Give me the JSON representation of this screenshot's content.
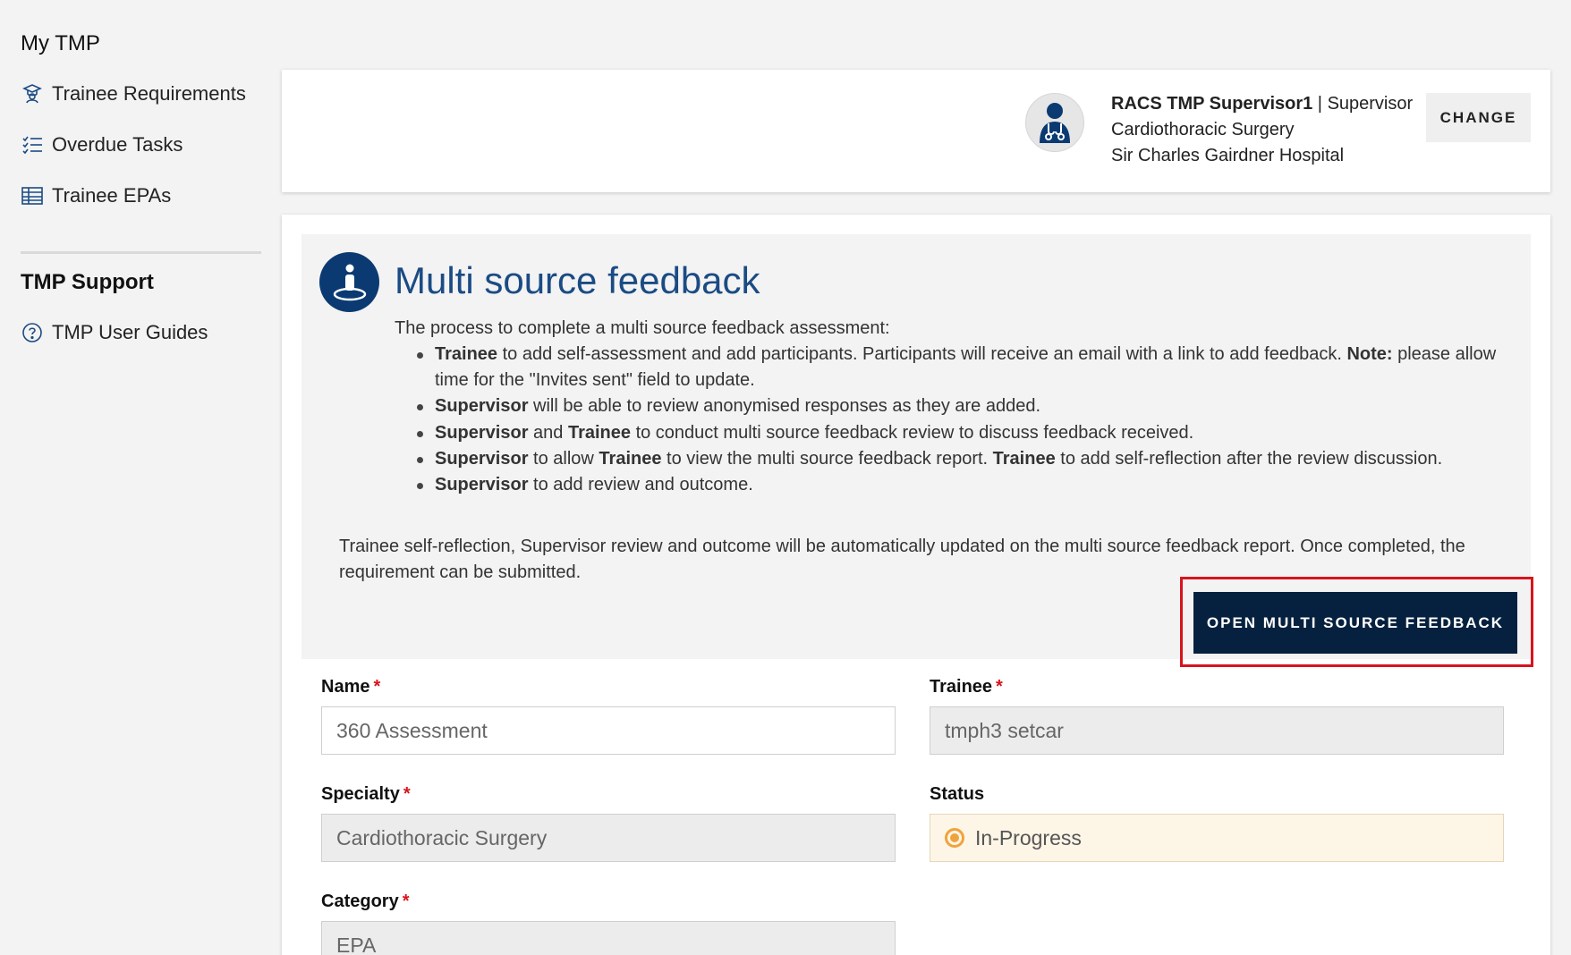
{
  "sidebar": {
    "title": "My TMP",
    "items": [
      {
        "label": "Trainee Requirements",
        "icon": "graduation-icon"
      },
      {
        "label": "Overdue Tasks",
        "icon": "checklist-icon"
      },
      {
        "label": "Trainee EPAs",
        "icon": "table-icon"
      }
    ],
    "support_title": "TMP Support",
    "support_items": [
      {
        "label": "TMP User Guides",
        "icon": "help-circle-icon"
      }
    ]
  },
  "header": {
    "user_name": "RACS TMP Supervisor1",
    "separator": " | ",
    "role": "Supervisor",
    "specialty": "Cardiothoracic Surgery",
    "hospital": "Sir Charles Gairdner Hospital",
    "change_label": "CHANGE",
    "avatar_icon": "doctor-icon"
  },
  "info": {
    "title": "Multi source feedback",
    "icon": "person-info-icon",
    "intro": "The process to complete a multi source feedback assessment:",
    "bullets": [
      [
        {
          "b": "Trainee"
        },
        {
          "t": " to add self-assessment and add participants. Participants will receive an email with a link to add feedback. "
        },
        {
          "b": "Note:"
        },
        {
          "t": " please allow time for the \"Invites sent\" field to update."
        }
      ],
      [
        {
          "b": "Supervisor"
        },
        {
          "t": " will be able to review anonymised responses as they are added."
        }
      ],
      [
        {
          "b": "Supervisor"
        },
        {
          "t": " and "
        },
        {
          "b": "Trainee"
        },
        {
          "t": " to conduct multi source feedback review to discuss feedback received."
        }
      ],
      [
        {
          "b": "Supervisor"
        },
        {
          "t": " to allow "
        },
        {
          "b": "Trainee"
        },
        {
          "t": " to view the multi source feedback report. "
        },
        {
          "b": "Trainee"
        },
        {
          "t": " to add self-reflection after the review discussion."
        }
      ],
      [
        {
          "b": "Supervisor"
        },
        {
          "t": " to add review and outcome."
        }
      ]
    ],
    "footer": "Trainee self-reflection, Supervisor review and outcome will be automatically updated on the multi source feedback report. Once completed, the requirement can be submitted.",
    "open_button": "OPEN MULTI SOURCE FEEDBACK"
  },
  "form": {
    "name_label": "Name",
    "name_value": "360 Assessment",
    "trainee_label": "Trainee",
    "trainee_value": "tmph3 setcar",
    "specialty_label": "Specialty",
    "specialty_value": "Cardiothoracic Surgery",
    "status_label": "Status",
    "status_value": "In-Progress",
    "category_label": "Category",
    "category_value": "EPA",
    "required_mark": "*",
    "status_color": "#f0a33d"
  },
  "colors": {
    "brand_navy": "#06213f",
    "title_blue": "#1b4b84",
    "highlight_red": "#d8131c"
  }
}
